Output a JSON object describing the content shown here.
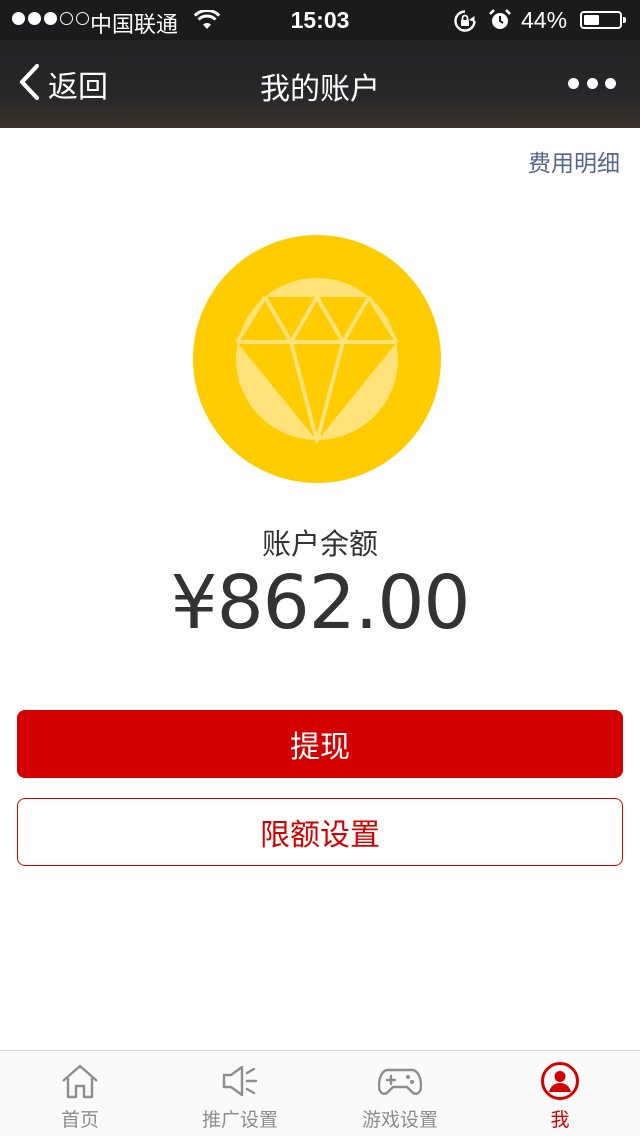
{
  "status_bar": {
    "carrier": "中国联通",
    "time": "15:03",
    "battery_percent": "44%",
    "battery_level": 0.44,
    "signal_bars_filled": 3,
    "signal_bars_total": 5
  },
  "nav": {
    "back_label": "返回",
    "title": "我的账户",
    "more_icon": "more-dots-icon"
  },
  "main": {
    "fee_detail_link": "费用明细",
    "badge_icon": "diamond-coin-icon",
    "balance_label": "账户余额",
    "balance_amount": "¥862.00"
  },
  "actions": {
    "withdraw_label": "提现",
    "limit_settings_label": "限额设置"
  },
  "tab_bar": {
    "items": [
      {
        "label": "首页",
        "icon": "home-icon"
      },
      {
        "label": "推广设置",
        "icon": "megaphone-icon"
      },
      {
        "label": "游戏设置",
        "icon": "gamepad-icon"
      },
      {
        "label": "我",
        "icon": "user-icon"
      }
    ],
    "active_index": 3
  },
  "colors": {
    "accent_red": "#d40000",
    "coin_gold": "#ffcc00",
    "coin_light": "#ffe37a",
    "link_blue": "#56668f"
  }
}
